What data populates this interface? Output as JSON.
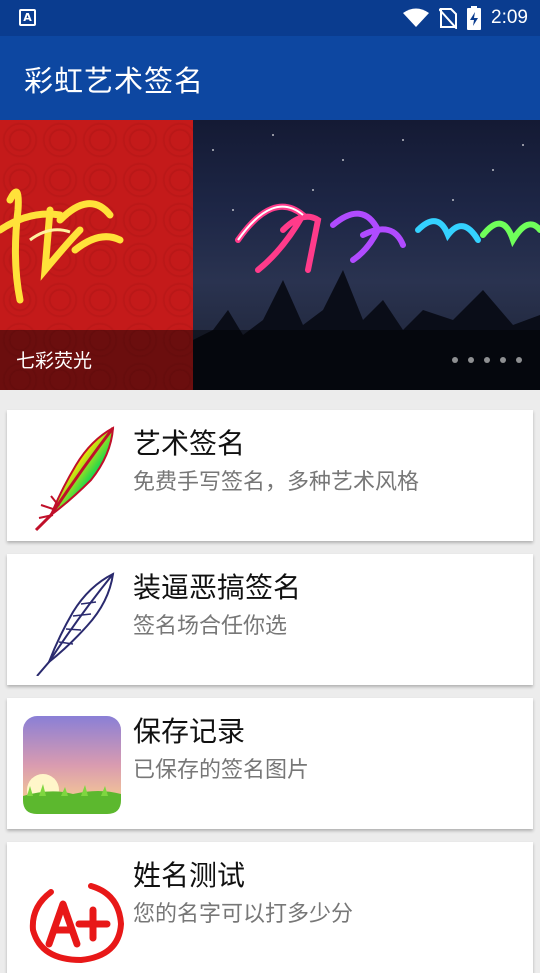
{
  "app": {
    "title": "彩虹艺术签名"
  },
  "statusbar": {
    "time": "2:09"
  },
  "banner": {
    "caption": "七彩荧光",
    "dots_count": 5,
    "colors": {
      "left_bg": "#c41a1a",
      "right_bg": "#1e2747"
    }
  },
  "cards": [
    {
      "title": "艺术签名",
      "subtitle": "免费手写签名，多种艺术风格",
      "icon": "rainbow-feather-icon"
    },
    {
      "title": "装逼恶搞签名",
      "subtitle": "签名场合任你选",
      "icon": "outline-feather-icon"
    },
    {
      "title": "保存记录",
      "subtitle": "已保存的签名图片",
      "icon": "gallery-image-icon"
    },
    {
      "title": "姓名测试",
      "subtitle": "您的名字可以打多少分",
      "icon": "a-plus-grade-icon"
    }
  ],
  "theme": {
    "primary": "#0d47a1",
    "statusbar": "#0a3c8f",
    "background": "#ececec"
  }
}
